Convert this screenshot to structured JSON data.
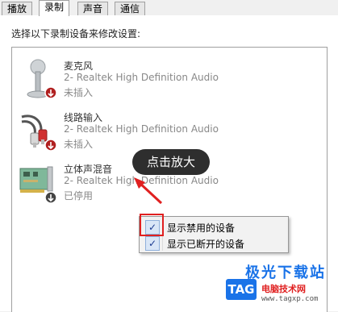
{
  "tabs": [
    {
      "label": "播放"
    },
    {
      "label": "录制"
    },
    {
      "label": "声音"
    },
    {
      "label": "通信"
    }
  ],
  "prompt": "选择以下录制设备来修改设置:",
  "devices": [
    {
      "name": "麦克风",
      "driver": "2- Realtek High Definition Audio",
      "status": "未插入",
      "icon": "microphone-icon",
      "badge": "unplugged-badge-icon"
    },
    {
      "name": "线路输入",
      "driver": "2- Realtek High Definition Audio",
      "status": "未插入",
      "icon": "line-in-cable-icon",
      "badge": "unplugged-badge-icon"
    },
    {
      "name": "立体声混音",
      "driver": "2- Realtek High Definition Audio",
      "status": "已停用",
      "icon": "sound-card-icon",
      "badge": "disabled-badge-icon"
    }
  ],
  "context_menu": {
    "items": [
      {
        "label": "显示禁用的设备",
        "checked": true
      },
      {
        "label": "显示已断开的设备",
        "checked": true
      }
    ]
  },
  "annotation": {
    "callout": "点击放大",
    "color": "#e02020"
  },
  "watermark": {
    "title": "极光下载站",
    "logo": "TAG",
    "subtitle": "电脑技术网",
    "url": "www.tagxp.com"
  }
}
